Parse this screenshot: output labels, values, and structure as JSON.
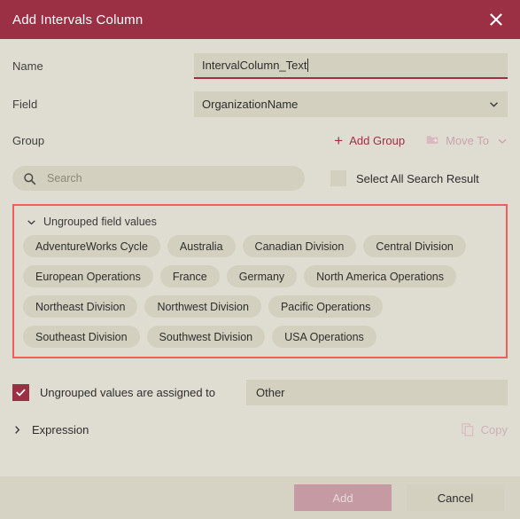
{
  "dialog": {
    "title": "Add Intervals Column",
    "close_icon": "close-icon"
  },
  "form": {
    "name": {
      "label": "Name",
      "value": "IntervalColumn_Text",
      "placeholder": "Name"
    },
    "field": {
      "label": "Field",
      "value": "OrganizationName",
      "chevron_icon": "chevron-down-icon"
    },
    "group": {
      "label": "Group",
      "add_group_label": "Add Group",
      "add_group_icon": "plus-icon",
      "move_to_label": "Move To",
      "move_to_icon": "folder-move-icon",
      "move_to_chevron_icon": "chevron-down-icon"
    }
  },
  "search": {
    "placeholder": "Search",
    "icon": "search-icon",
    "select_all_label": "Select All Search Result",
    "select_all_checked": false
  },
  "values_panel": {
    "header_label": "Ungrouped field values",
    "expanded_icon": "chevron-down-icon",
    "highlight_color": "#f15d5d",
    "tags": [
      "AdventureWorks Cycle",
      "Australia",
      "Canadian Division",
      "Central Division",
      "European Operations",
      "France",
      "Germany",
      "North America Operations",
      "Northeast Division",
      "Northwest Division",
      "Pacific Operations",
      "Southeast Division",
      "Southwest Division",
      "USA Operations"
    ]
  },
  "assign": {
    "checked": true,
    "label": "Ungrouped values are assigned to",
    "value": "Other"
  },
  "expression": {
    "label": "Expression",
    "collapsed_icon": "chevron-right-icon",
    "copy_label": "Copy",
    "copy_icon": "copy-icon"
  },
  "footer": {
    "add_label": "Add",
    "cancel_label": "Cancel"
  },
  "theme": {
    "accent": "#9b3045",
    "background": "#dfddd1",
    "control": "#d3d0bf",
    "footer_bg": "#d6d3c4"
  }
}
